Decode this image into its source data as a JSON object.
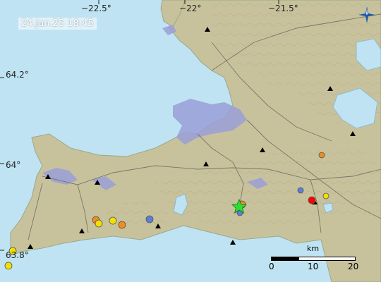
{
  "map": {
    "timestamp": "24.jan.25  18:45",
    "top_ticks": [
      "−22.5°",
      "−22°",
      "−21.5°"
    ],
    "left_ticks": [
      "64.2°",
      "64°",
      "63.8°"
    ],
    "scale": {
      "unit": "km",
      "labels": [
        "0",
        "10",
        "20"
      ]
    },
    "compass_icon": "north-arrow-star-icon",
    "colors": {
      "sea": "#bfe3f2",
      "land": "#c8c29c",
      "lava": "#9a9fd8",
      "earthquake_recent": "#ff0000",
      "earthquake_hours": "#f08c1e",
      "earthquake_day": "#f2e000",
      "earthquake_older": "#5c7fd6",
      "largest_event_star": "#2ee02e"
    }
  }
}
